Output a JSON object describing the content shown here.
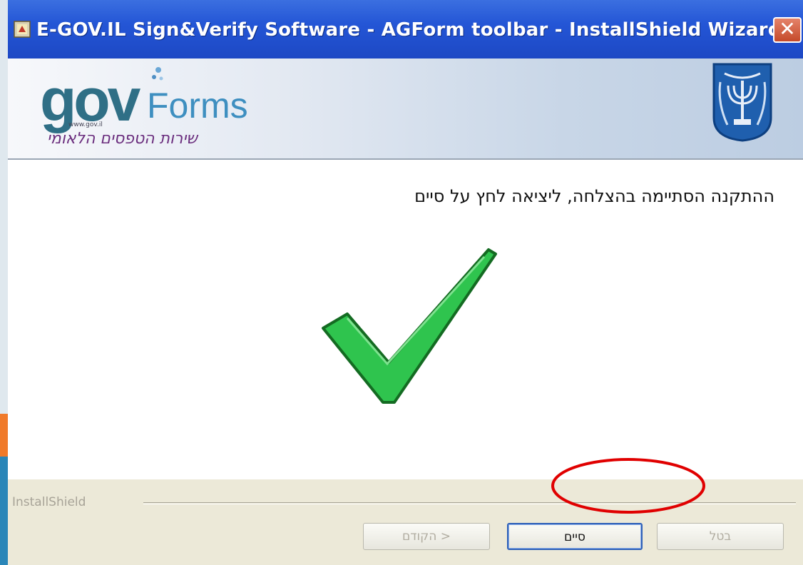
{
  "window": {
    "title": "E-GOV.IL Sign&Verify Software - AGForm toolbar - InstallShield Wizard",
    "close_label": "✕"
  },
  "banner": {
    "logo_gov": "gov",
    "logo_forms": "Forms",
    "logo_url": "www.gov.il",
    "logo_subtitle": "שירות הטפסים הלאומי",
    "emblem_icon": "state-emblem-icon"
  },
  "content": {
    "message": "ההתקנה הסתיימה בהצלחה,  ליציאה לחץ על סיים",
    "status_icon": "checkmark-icon",
    "status_color": "#29c24a"
  },
  "footer": {
    "brand": "InstallShield",
    "back_label": "< הקודם",
    "finish_label": "סיים",
    "cancel_label": "בטל"
  },
  "annotation": {
    "highlight_color": "#e00000"
  }
}
